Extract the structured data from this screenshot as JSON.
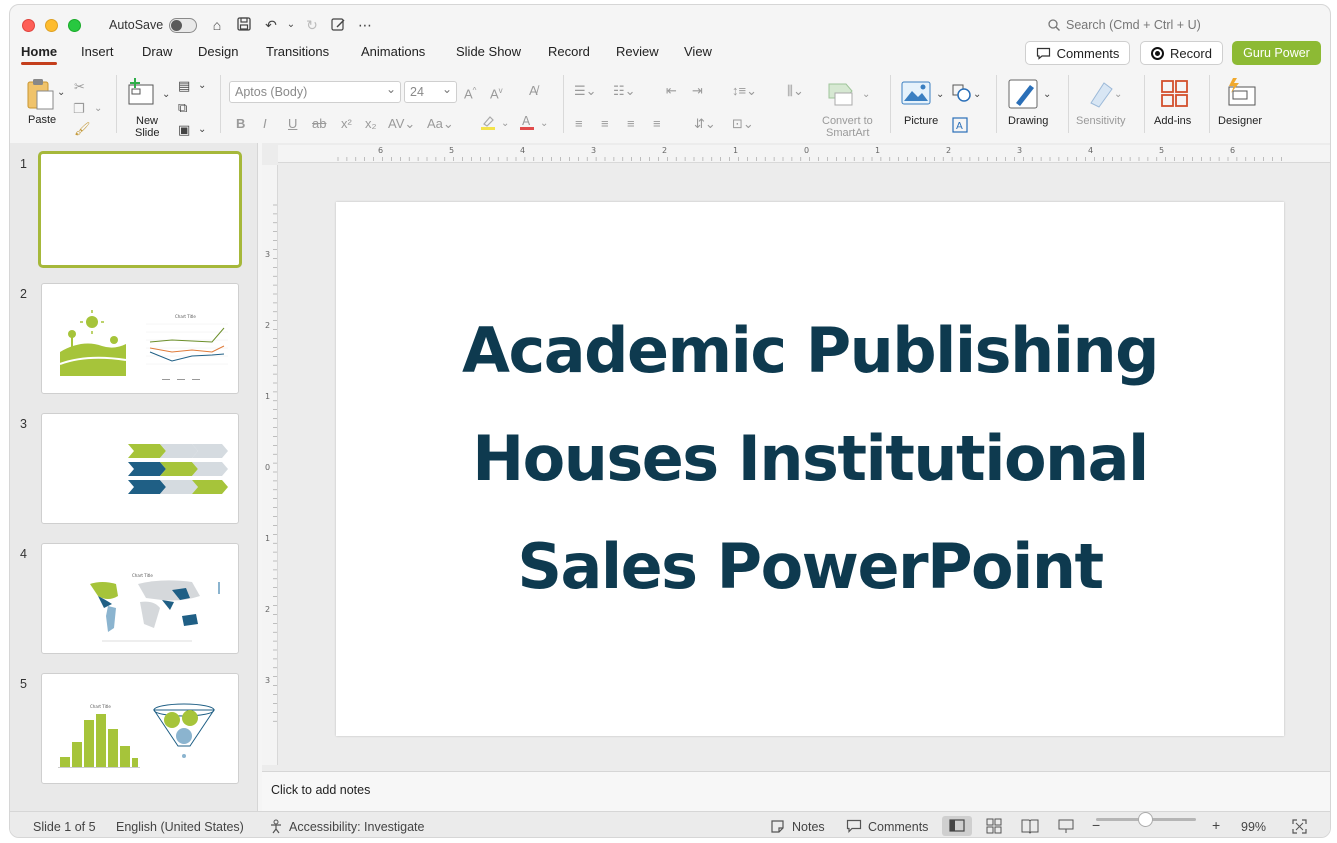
{
  "titlebar": {
    "autosave_label": "AutoSave",
    "search_placeholder": "Search (Cmd + Ctrl + U)"
  },
  "tabs": [
    {
      "label": "Home",
      "active": true
    },
    {
      "label": "Insert"
    },
    {
      "label": "Draw"
    },
    {
      "label": "Design"
    },
    {
      "label": "Transitions"
    },
    {
      "label": "Animations"
    },
    {
      "label": "Slide Show"
    },
    {
      "label": "Record"
    },
    {
      "label": "Review"
    },
    {
      "label": "View"
    }
  ],
  "header_buttons": {
    "comments": "Comments",
    "record": "Record",
    "guru": "Guru Power"
  },
  "ribbon": {
    "paste": "Paste",
    "new_slide_1": "New",
    "new_slide_2": "Slide",
    "font_name": "Aptos (Body)",
    "font_size": "24",
    "convert_1": "Convert to",
    "convert_2": "SmartArt",
    "picture": "Picture",
    "drawing": "Drawing",
    "sensitivity": "Sensitivity",
    "addins": "Add-ins",
    "designer": "Designer"
  },
  "thumbnails": [
    {
      "number": "1",
      "selected": true
    },
    {
      "number": "2",
      "chart_title": "Chart Title"
    },
    {
      "number": "3"
    },
    {
      "number": "4",
      "chart_title": "Chart Title"
    },
    {
      "number": "5",
      "chart_title": "Chart Title"
    }
  ],
  "ruler": {
    "h_ticks": [
      "6",
      "5",
      "4",
      "3",
      "2",
      "1",
      "0",
      "1",
      "2",
      "3",
      "4",
      "5",
      "6"
    ],
    "v_ticks": [
      "3",
      "2",
      "1",
      "0",
      "1",
      "2",
      "3"
    ]
  },
  "slide": {
    "title_line1": "Academic Publishing",
    "title_line2": "Houses Institutional",
    "title_line3": "Sales PowerPoint"
  },
  "notes_placeholder": "Click to add notes",
  "status": {
    "slide_of": "Slide 1 of 5",
    "language": "English (United States)",
    "accessibility": "Accessibility: Investigate",
    "notes": "Notes",
    "comments": "Comments",
    "zoom": "99%"
  },
  "colors": {
    "accent_tab": "#c43e1c",
    "guru_green": "#8dba34",
    "title_navy": "#0e3a4f",
    "thumb_green": "#a6c43a",
    "thumb_blue": "#1f5f85"
  }
}
